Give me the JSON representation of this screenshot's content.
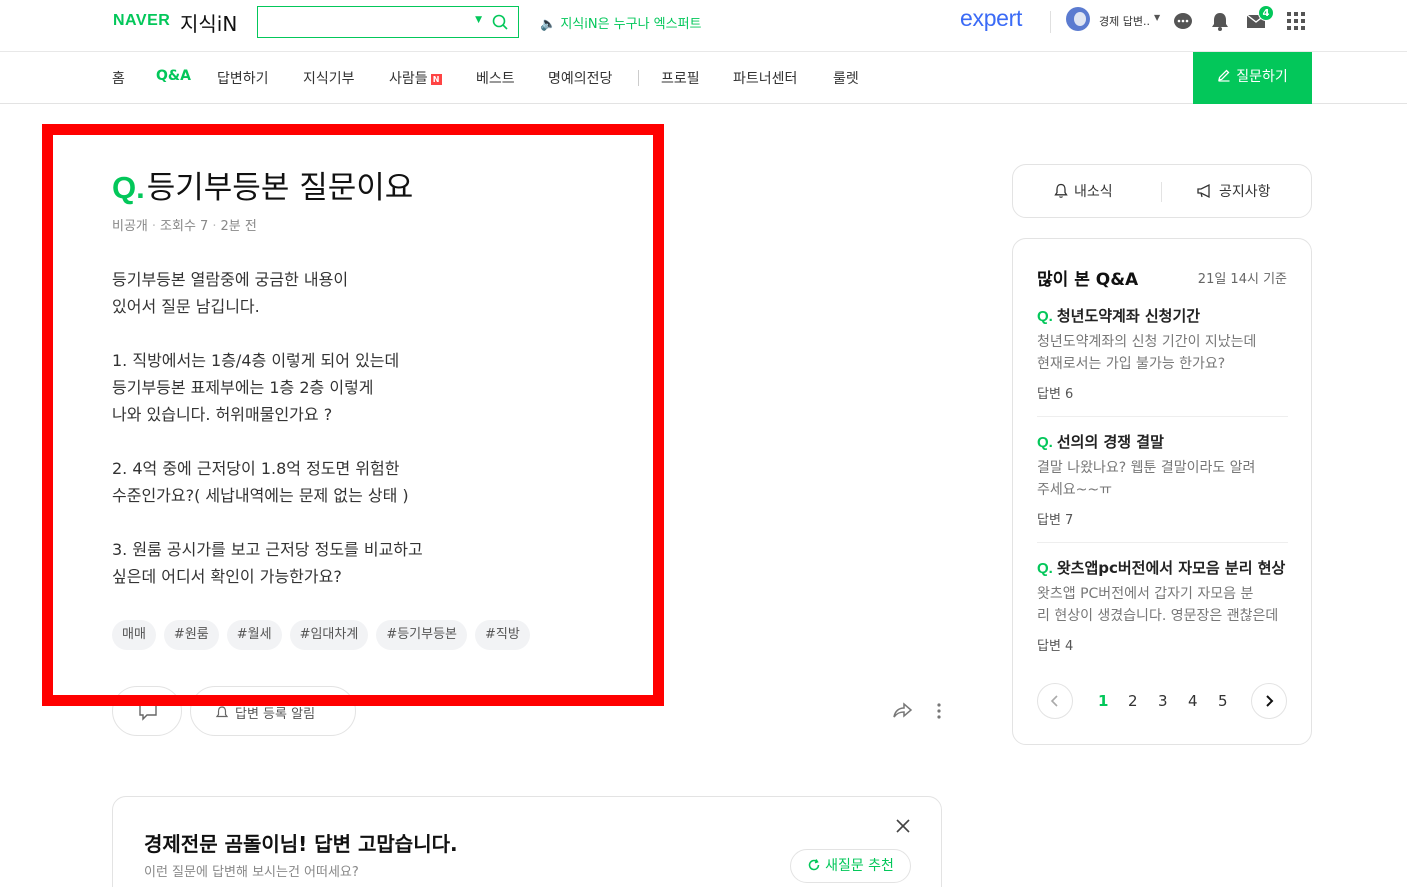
{
  "header": {
    "logo_naver": "NAVER",
    "logo_kin": "지식iN",
    "search_value": "",
    "notice": "🔈 지식iN은 누구나 엑스퍼트",
    "expert_logo": "expert",
    "user_name": "경제 답변..",
    "mail_badge": "4"
  },
  "nav": {
    "items": [
      "홈",
      "Q&A",
      "답변하기",
      "지식기부",
      "사람들",
      "베스트",
      "명예의전당",
      "프로필",
      "파트너센터",
      "룰렛"
    ],
    "active": "Q&A",
    "new_mark": "N",
    "ask_button": "질문하기"
  },
  "question": {
    "mark": "Q.",
    "title": "등기부등본 질문이요",
    "visibility": "비공개",
    "views": "조회수 7",
    "time": "2분 전",
    "body": [
      "등기부등본 열람중에 궁금한 내용이",
      "있어서 질문 남깁니다.",
      "",
      "1. 직방에서는 1층/4층 이렇게 되어 있는데",
      "등기부등본 표제부에는 1층 2층 이렇게",
      "나와 있습니다. 허위매물인가요 ?",
      "",
      "2. 4억 중에 근저당이 1.8억 정도면 위험한",
      "수준인가요?( 세납내역에는 문제 없는 상태 )",
      "",
      "3. 원룸 공시가를 보고 근저당 정도를 비교하고",
      "싶은데 어디서 확인이 가능한가요?"
    ],
    "tags": [
      "매매",
      "#원룸",
      "#월세",
      "#임대차계",
      "#등기부등본",
      "#직방"
    ],
    "alert_button": "답변 등록 알림"
  },
  "answer_prompt": {
    "title": "경제전문 곰돌이님! 답변 고맙습니다.",
    "subtitle": "이런 질문에 답변해 보시는건 어떠세요?",
    "new_question_button": "새질문 추천"
  },
  "sidebar": {
    "news": "내소식",
    "notice": "공지사항",
    "popular": {
      "title": "많이 본 Q&A",
      "time": "21일 14시 기준",
      "items": [
        {
          "title": "청년도약계좌 신청기간",
          "desc1": "청년도약계좌의 신청 기간이 지났는데",
          "desc2": "현재로서는 가입 불가능 한가요?",
          "answers": "답변 6"
        },
        {
          "title": "선의의 경쟁 결말",
          "desc1": "결말 나왔나요? 웹툰 결말이라도 알려",
          "desc2": "주세요~~ㅠ",
          "answers": "답변 7"
        },
        {
          "title": "왓츠앱pc버전에서 자모음 분리 현상",
          "desc1": "왓츠앱 PC버전에서 갑자기 자모음 분",
          "desc2": "리 현상이 생겼습니다. 영문장은 괜찮은데",
          "answers": "답변 4"
        }
      ],
      "pages": [
        "1",
        "2",
        "3",
        "4",
        "5"
      ],
      "current_page": "1"
    }
  },
  "colors": {
    "brand": "#03c75a",
    "highlight": "#ff0000",
    "expert": "#3b6bf6"
  }
}
